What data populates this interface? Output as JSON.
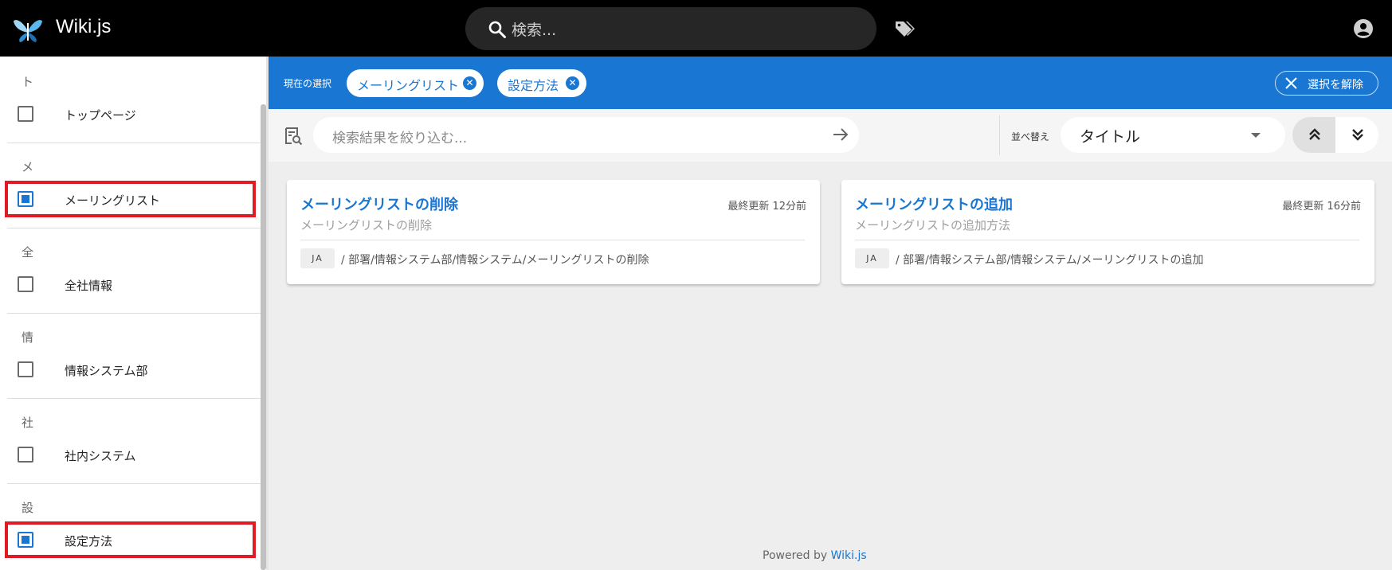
{
  "header": {
    "brand": "Wiki.js",
    "search_placeholder": "検索...",
    "icons": [
      "wikijs-logo-icon",
      "search-icon",
      "tags-icon",
      "account-icon"
    ]
  },
  "sidebar": {
    "groups": [
      {
        "letter": "ト",
        "label": "トップページ",
        "checked": false
      },
      {
        "letter": "メ",
        "label": "メーリングリスト",
        "checked": true
      },
      {
        "letter": "全",
        "label": "全社情報",
        "checked": false
      },
      {
        "letter": "情",
        "label": "情報システム部",
        "checked": false
      },
      {
        "letter": "社",
        "label": "社内システム",
        "checked": false
      },
      {
        "letter": "設",
        "label": "設定方法",
        "checked": true
      }
    ]
  },
  "selection": {
    "caption": "現在の選択",
    "chips": [
      "メーリングリスト",
      "設定方法"
    ],
    "clear_label": "選択を解除"
  },
  "filter": {
    "placeholder": "検索結果を絞り込む...",
    "sort_caption": "並べ替え",
    "sort_value": "タイトル"
  },
  "results": [
    {
      "title": "メーリングリストの削除",
      "description": "メーリングリストの削除",
      "updated": "最終更新 12分前",
      "locale": "JA",
      "path": "/ 部署/情報システム部/情報システム/メーリングリストの削除"
    },
    {
      "title": "メーリングリストの追加",
      "description": "メーリングリストの追加方法",
      "updated": "最終更新 16分前",
      "locale": "JA",
      "path": "/ 部署/情報システム部/情報システム/メーリングリストの追加"
    }
  ],
  "footer": {
    "prefix": "Powered by ",
    "link": "Wiki.js"
  },
  "colors": {
    "topbar": "#000000",
    "accent": "#1976d2",
    "highlight": "#e01b24"
  }
}
